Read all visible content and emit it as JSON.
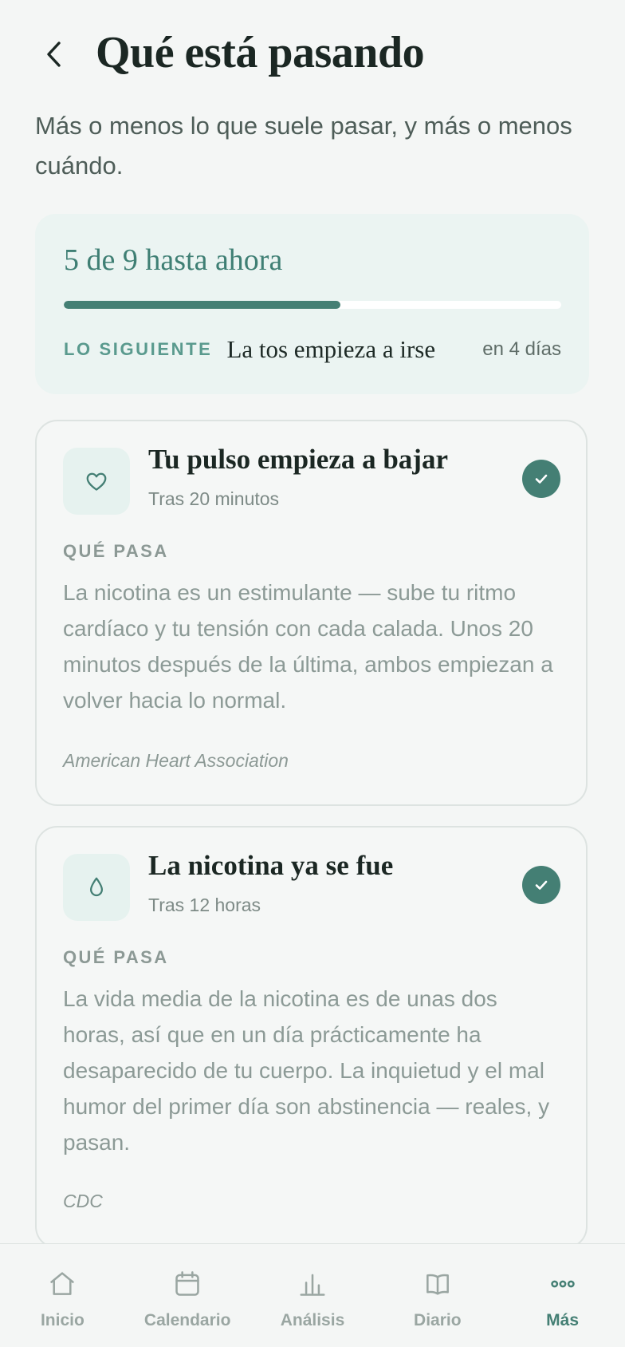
{
  "header": {
    "title": "Qué está pasando",
    "subtitle": "Más o menos lo que suele pasar, y más o menos cuándo."
  },
  "progress": {
    "label": "5 de 9 hasta ahora",
    "completed": 5,
    "total": 9,
    "next_label": "LO SIGUIENTE",
    "next_event": "La tos empieza a irse",
    "next_when": "en 4 días"
  },
  "milestones": [
    {
      "icon": "heart-icon",
      "title": "Tu pulso empieza a bajar",
      "time": "Tras 20 minutos",
      "section": "QUÉ PASA",
      "body": "La nicotina es un estimulante — sube tu ritmo cardíaco y tu tensión con cada calada. Unos 20 minutos después de la última, ambos empiezan a volver hacia lo normal.",
      "source": "American Heart Association",
      "done": true
    },
    {
      "icon": "droplet-icon",
      "title": "La nicotina ya se fue",
      "time": "Tras 12 horas",
      "section": "QUÉ PASA",
      "body": "La vida media de la nicotina es de unas dos horas, así que en un día prácticamente ha desaparecido de tu cuerpo. La inquietud y el mal humor del primer día son abstinencia — reales, y pasan.",
      "source": "CDC",
      "done": true
    }
  ],
  "nav": {
    "items": [
      {
        "label": "Inicio",
        "icon": "home-icon"
      },
      {
        "label": "Calendario",
        "icon": "calendar-icon"
      },
      {
        "label": "Análisis",
        "icon": "bar-chart-icon"
      },
      {
        "label": "Diario",
        "icon": "book-icon"
      },
      {
        "label": "Más",
        "icon": "more-icon"
      }
    ],
    "active": "Más"
  },
  "colors": {
    "accent": "#447f74",
    "background": "#f4f6f5",
    "card_tint": "#ebf4f2",
    "text_dark": "#1b2723",
    "text_muted": "#8c9a96"
  }
}
